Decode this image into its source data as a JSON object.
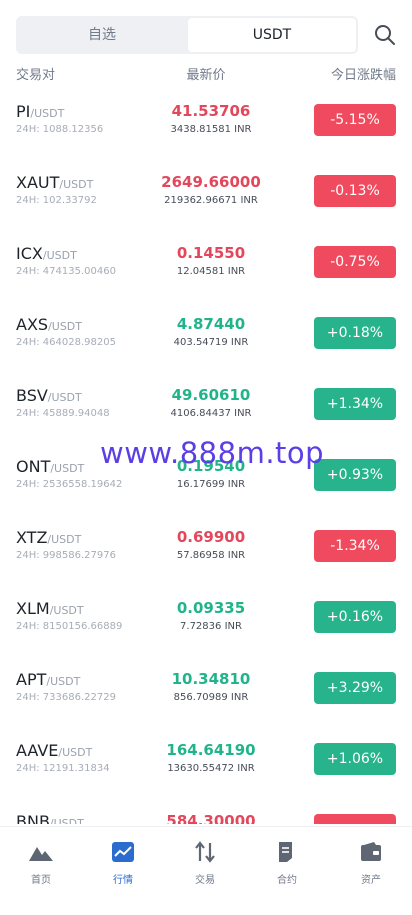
{
  "segments": {
    "watchlist": "自选",
    "usdt": "USDT"
  },
  "headers": {
    "pair": "交易对",
    "price": "最新价",
    "change": "今日涨跌幅"
  },
  "rows": [
    {
      "base": "PI",
      "quote": "/USDT",
      "vol": "24H: 1088.12356",
      "price": "41.53706",
      "fiat": "3438.81581 INR",
      "change": "-5.15%",
      "dir": "down"
    },
    {
      "base": "XAUT",
      "quote": "/USDT",
      "vol": "24H: 102.33792",
      "price": "2649.66000",
      "fiat": "219362.96671 INR",
      "change": "-0.13%",
      "dir": "down"
    },
    {
      "base": "ICX",
      "quote": "/USDT",
      "vol": "24H: 474135.00460",
      "price": "0.14550",
      "fiat": "12.04581 INR",
      "change": "-0.75%",
      "dir": "down"
    },
    {
      "base": "AXS",
      "quote": "/USDT",
      "vol": "24H: 464028.98205",
      "price": "4.87440",
      "fiat": "403.54719 INR",
      "change": "+0.18%",
      "dir": "up"
    },
    {
      "base": "BSV",
      "quote": "/USDT",
      "vol": "24H: 45889.94048",
      "price": "49.60610",
      "fiat": "4106.84437 INR",
      "change": "+1.34%",
      "dir": "up"
    },
    {
      "base": "ONT",
      "quote": "/USDT",
      "vol": "24H: 2536558.19642",
      "price": "0.19540",
      "fiat": "16.17699 INR",
      "change": "+0.93%",
      "dir": "up"
    },
    {
      "base": "XTZ",
      "quote": "/USDT",
      "vol": "24H: 998586.27976",
      "price": "0.69900",
      "fiat": "57.86958 INR",
      "change": "-1.34%",
      "dir": "down"
    },
    {
      "base": "XLM",
      "quote": "/USDT",
      "vol": "24H: 8150156.66889",
      "price": "0.09335",
      "fiat": "7.72836 INR",
      "change": "+0.16%",
      "dir": "up"
    },
    {
      "base": "APT",
      "quote": "/USDT",
      "vol": "24H: 733686.22729",
      "price": "10.34810",
      "fiat": "856.70989 INR",
      "change": "+3.29%",
      "dir": "up"
    },
    {
      "base": "AAVE",
      "quote": "/USDT",
      "vol": "24H: 12191.31834",
      "price": "164.64190",
      "fiat": "13630.55472 INR",
      "change": "+1.06%",
      "dir": "up"
    },
    {
      "base": "BNB",
      "quote": "/USDT",
      "vol": "",
      "price": "584.30000",
      "fiat": "",
      "change": "",
      "dir": "down"
    }
  ],
  "watermark": "www.888m.top",
  "tabs": {
    "home": "首页",
    "market": "行情",
    "trade": "交易",
    "contract": "合约",
    "assets": "资产"
  },
  "colors": {
    "up": "#27b48c",
    "down": "#ef4a5d",
    "active": "#2d6ccf"
  },
  "icons": [
    "search-icon",
    "home-mountain-icon",
    "market-chart-icon",
    "trade-arrows-icon",
    "contract-document-icon",
    "assets-wallet-icon"
  ]
}
